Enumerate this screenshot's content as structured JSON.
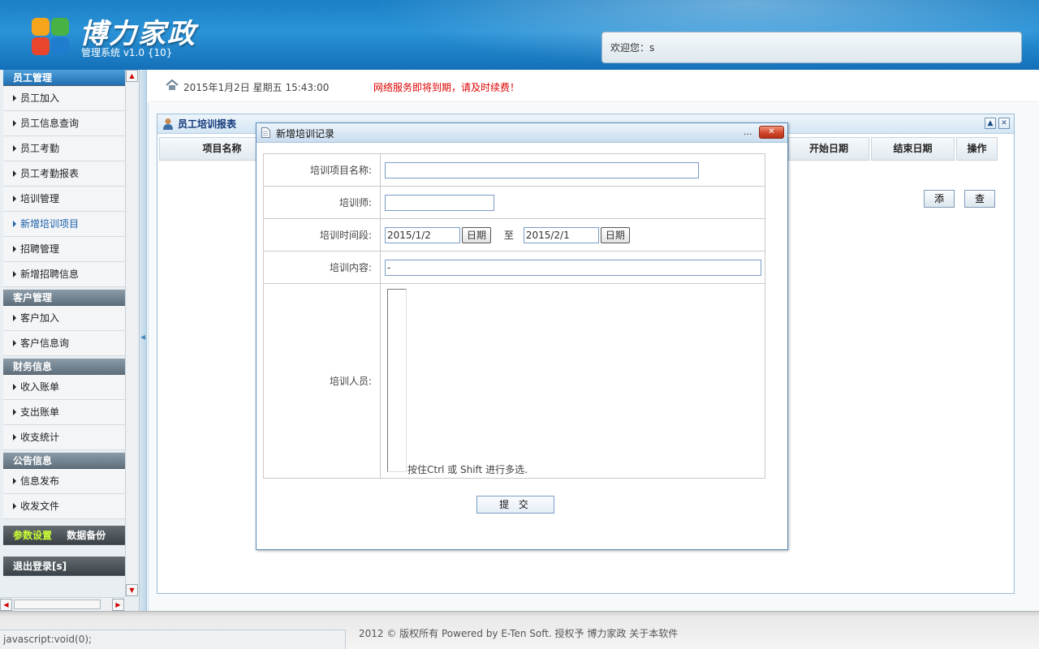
{
  "header": {
    "brand": "博力家政",
    "subtitle": "管理系统 v1.0 {10}",
    "welcome": "欢迎您：s"
  },
  "sidebar": {
    "sections": [
      {
        "title": "员工管理",
        "items": [
          "员工加入",
          "员工信息查询",
          "员工考勤",
          "员工考勤报表",
          "培训管理",
          "新增培训项目",
          "招聘管理",
          "新增招聘信息"
        ]
      },
      {
        "title": "客户管理",
        "items": [
          "客户加入",
          "客户信息询"
        ]
      },
      {
        "title": "财务信息",
        "items": [
          "收入账单",
          "支出账单",
          "收支统计"
        ]
      },
      {
        "title": "公告信息",
        "items": [
          "信息发布",
          "收发文件"
        ]
      }
    ],
    "active_item": "新增培训项目",
    "settings": "参数设置",
    "backup": "数据备份",
    "logout": "退出登录[s]"
  },
  "topbar": {
    "datetime": "2015年1月2日  星期五  15:43:00",
    "notice": "网络服务即将到期，请及时续费！"
  },
  "panel": {
    "title": "员工培训报表",
    "columns": [
      "项目名称",
      "开始日期",
      "结束日期",
      "操作"
    ],
    "add_button": "添",
    "query_button": "查"
  },
  "dialog": {
    "title": "新增培训记录",
    "fields": {
      "name_label": "培训项目名称:",
      "name_value": "",
      "trainer_label": "培训师:",
      "trainer_value": "",
      "period_label": "培训时间段:",
      "start_date": "2015/1/2",
      "end_date": "2015/2/1",
      "date_button": "日期",
      "to": "至",
      "content_label": "培训内容:",
      "content_value": "-",
      "staff_label": "培训人员:",
      "staff_hint": "按住Ctrl 或  Shift 进行多选."
    },
    "submit": "提 交",
    "minimize": "..."
  },
  "footer": {
    "copyright": "2012 © 版权所有  Powered by E-Ten Soft. 授权予 博力家政  关于本软件",
    "status": "javascript:void(0);"
  },
  "colors": {
    "header": "#1b80c6",
    "notice": "#dd0000",
    "accent_text": "#ccff33"
  }
}
